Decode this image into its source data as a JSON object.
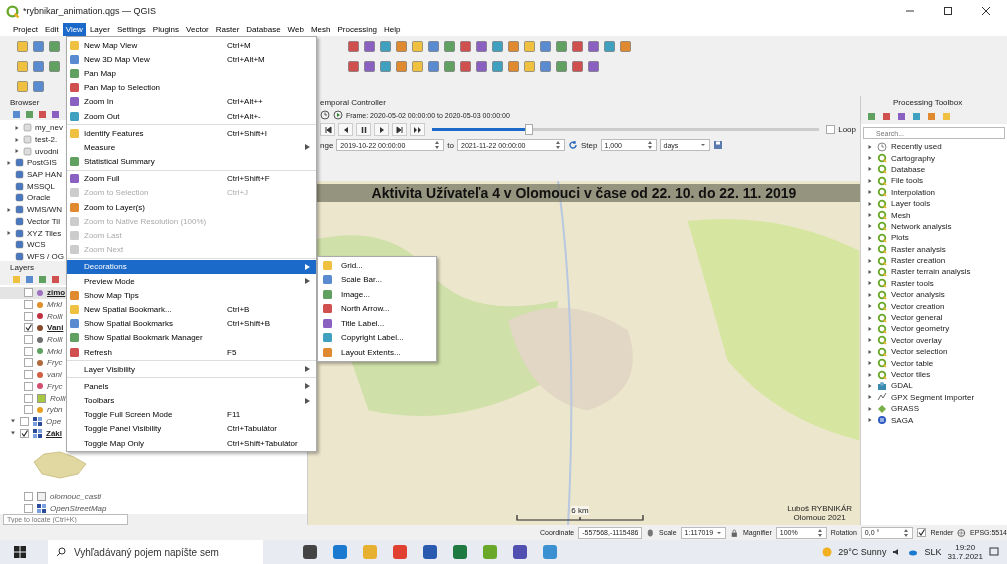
{
  "window": {
    "title": "*rybnikar_animation.qgs — QGIS"
  },
  "menubar": [
    {
      "label": "Project",
      "selected": false
    },
    {
      "label": "Edit",
      "selected": false
    },
    {
      "label": "View",
      "selected": true
    },
    {
      "label": "Layer",
      "selected": false
    },
    {
      "label": "Settings",
      "selected": false
    },
    {
      "label": "Plugins",
      "selected": false
    },
    {
      "label": "Vector",
      "selected": false
    },
    {
      "label": "Raster",
      "selected": false
    },
    {
      "label": "Database",
      "selected": false
    },
    {
      "label": "Web",
      "selected": false
    },
    {
      "label": "Mesh",
      "selected": false
    },
    {
      "label": "Processing",
      "selected": false
    },
    {
      "label": "Help",
      "selected": false
    }
  ],
  "browser": {
    "title": "Browser",
    "items": [
      {
        "label": "my_nev",
        "expandable": true,
        "indent": true
      },
      {
        "label": "test-2.",
        "expandable": true,
        "indent": true
      },
      {
        "label": "uvodni",
        "expandable": true,
        "indent": true
      },
      {
        "label": "PostGIS",
        "expandable": true,
        "indent": false
      },
      {
        "label": "SAP HAN",
        "expandable": false,
        "indent": false
      },
      {
        "label": "MSSQL",
        "expandable": false,
        "indent": false
      },
      {
        "label": "Oracle",
        "expandable": false,
        "indent": false
      },
      {
        "label": "WMS/WN",
        "expandable": true,
        "indent": false
      },
      {
        "label": "Vector Til",
        "expandable": false,
        "indent": false
      },
      {
        "label": "XYZ Tiles",
        "expandable": true,
        "indent": false
      },
      {
        "label": "WCS",
        "expandable": false,
        "indent": false
      },
      {
        "label": "WFS / OG",
        "expandable": false,
        "indent": false
      }
    ]
  },
  "layers": {
    "title": "Layers",
    "items": [
      {
        "kind": "point",
        "label": "zimo",
        "checked": false,
        "selected": true,
        "color": "#a070c0"
      },
      {
        "kind": "point",
        "label": "Mrkl",
        "checked": false,
        "selected": false,
        "color": "#e0902a"
      },
      {
        "kind": "point",
        "label": "Rolli",
        "checked": false,
        "selected": false,
        "color": "#c03040"
      },
      {
        "kind": "point",
        "label": "Vani",
        "checked": true,
        "selected": false,
        "color": "#8a4a2a"
      },
      {
        "kind": "point",
        "label": "Rolli",
        "checked": false,
        "selected": false,
        "color": "#707070"
      },
      {
        "kind": "point",
        "label": "Mrkl",
        "checked": false,
        "selected": false,
        "color": "#60a060"
      },
      {
        "kind": "point",
        "label": "Fryc",
        "checked": false,
        "selected": false,
        "color": "#b06a40"
      },
      {
        "kind": "point",
        "label": "vani",
        "checked": false,
        "selected": false,
        "color": "#d06040"
      },
      {
        "kind": "point",
        "label": "Fryc",
        "checked": false,
        "selected": false,
        "color": "#d05070"
      },
      {
        "kind": "polygon",
        "label": "Rolli",
        "checked": false,
        "selected": false,
        "color": "#a8c840"
      },
      {
        "kind": "point",
        "label": "rybn",
        "checked": false,
        "selected": false,
        "color": "#e8a020"
      },
      {
        "kind": "group",
        "label": "Ope",
        "checked": false,
        "selected": false,
        "expanded": true
      },
      {
        "kind": "group",
        "label": "Zákl",
        "checked": true,
        "selected": false,
        "expanded": true
      },
      {
        "kind": "thumbnail",
        "color": "#e0d8a0"
      },
      {
        "kind": "polygon",
        "label": "olomouc_casti",
        "checked": false,
        "selected": false,
        "color": "#f0f0f0"
      },
      {
        "kind": "group",
        "label": "OpenStreetMap",
        "checked": false,
        "selected": false,
        "expanded": false
      }
    ],
    "locate": {
      "placeholder": "Type to locate (Ctrl+K)"
    }
  },
  "view_menu": [
    {
      "kind": "item",
      "label": "New Map View",
      "shortcut": "Ctrl+M",
      "disabled": false,
      "selected": false,
      "submenu": false,
      "icon": true
    },
    {
      "kind": "item",
      "label": "New 3D Map View",
      "shortcut": "Ctrl+Alt+M",
      "disabled": false,
      "selected": false,
      "submenu": false,
      "icon": true
    },
    {
      "kind": "item",
      "label": "Pan Map",
      "disabled": false,
      "selected": false,
      "submenu": false,
      "icon": true
    },
    {
      "kind": "item",
      "label": "Pan Map to Selection",
      "disabled": false,
      "selected": false,
      "submenu": false,
      "icon": true
    },
    {
      "kind": "item",
      "label": "Zoom In",
      "shortcut": "Ctrl+Alt++",
      "disabled": false,
      "selected": false,
      "submenu": false,
      "icon": true
    },
    {
      "kind": "item",
      "label": "Zoom Out",
      "shortcut": "Ctrl+Alt+-",
      "disabled": false,
      "selected": false,
      "submenu": false,
      "icon": true
    },
    {
      "kind": "separator"
    },
    {
      "kind": "item",
      "label": "Identify Features",
      "shortcut": "Ctrl+Shift+I",
      "disabled": false,
      "selected": false,
      "submenu": false,
      "icon": true
    },
    {
      "kind": "item",
      "label": "Measure",
      "disabled": false,
      "selected": false,
      "submenu": true,
      "icon": false
    },
    {
      "kind": "item",
      "label": "Statistical Summary",
      "disabled": false,
      "selected": false,
      "submenu": false,
      "icon": true
    },
    {
      "kind": "separator"
    },
    {
      "kind": "item",
      "label": "Zoom Full",
      "shortcut": "Ctrl+Shift+F",
      "disabled": false,
      "selected": false,
      "submenu": false,
      "icon": true
    },
    {
      "kind": "item",
      "label": "Zoom to Selection",
      "shortcut": "Ctrl+J",
      "disabled": true,
      "selected": false,
      "submenu": false,
      "icon": true
    },
    {
      "kind": "item",
      "label": "Zoom to Layer(s)",
      "disabled": false,
      "selected": false,
      "submenu": false,
      "icon": true
    },
    {
      "kind": "item",
      "label": "Zoom to Native Resolution (100%)",
      "disabled": true,
      "selected": false,
      "submenu": false,
      "icon": true
    },
    {
      "kind": "item",
      "label": "Zoom Last",
      "disabled": true,
      "selected": false,
      "submenu": false,
      "icon": true
    },
    {
      "kind": "item",
      "label": "Zoom Next",
      "disabled": true,
      "selected": false,
      "submenu": false,
      "icon": true
    },
    {
      "kind": "separator"
    },
    {
      "kind": "item",
      "label": "Decorations",
      "disabled": false,
      "selected": true,
      "submenu": true,
      "icon": false
    },
    {
      "kind": "item",
      "label": "Preview Mode",
      "disabled": false,
      "selected": false,
      "submenu": true,
      "icon": false
    },
    {
      "kind": "item",
      "label": "Show Map Tips",
      "disabled": false,
      "selected": false,
      "submenu": false,
      "icon": true
    },
    {
      "kind": "item",
      "label": "New Spatial Bookmark...",
      "shortcut": "Ctrl+B",
      "disabled": false,
      "selected": false,
      "submenu": false,
      "icon": true
    },
    {
      "kind": "item",
      "label": "Show Spatial Bookmarks",
      "shortcut": "Ctrl+Shift+B",
      "disabled": false,
      "selected": false,
      "submenu": false,
      "icon": true
    },
    {
      "kind": "item",
      "label": "Show Spatial Bookmark Manager",
      "disabled": false,
      "selected": false,
      "submenu": false,
      "icon": true
    },
    {
      "kind": "item",
      "label": "Refresh",
      "shortcut": "F5",
      "disabled": false,
      "selected": false,
      "submenu": false,
      "icon": true
    },
    {
      "kind": "separator"
    },
    {
      "kind": "item",
      "label": "Layer Visibility",
      "disabled": false,
      "selected": false,
      "submenu": true,
      "icon": false
    },
    {
      "kind": "separator"
    },
    {
      "kind": "item",
      "label": "Panels",
      "disabled": false,
      "selected": false,
      "submenu": true,
      "icon": false
    },
    {
      "kind": "item",
      "label": "Toolbars",
      "disabled": false,
      "selected": false,
      "submenu": true,
      "icon": false
    },
    {
      "kind": "item",
      "label": "Toggle Full Screen Mode",
      "shortcut": "F11",
      "disabled": false,
      "selected": false,
      "submenu": false,
      "icon": false
    },
    {
      "kind": "item",
      "label": "Toggle Panel Visibility",
      "shortcut": "Ctrl+Tabulátor",
      "disabled": false,
      "selected": false,
      "submenu": false,
      "icon": false
    },
    {
      "kind": "item",
      "label": "Toggle Map Only",
      "shortcut": "Ctrl+Shift+Tabulátor",
      "disabled": false,
      "selected": false,
      "submenu": false,
      "icon": false
    }
  ],
  "decorations_menu": [
    "Grid...",
    "Scale Bar...",
    "Image...",
    "North Arrow...",
    "Title Label...",
    "Copyright Label...",
    "Layout Extents..."
  ],
  "temporal": {
    "title": "emporal Controller",
    "frame": "Frame: 2020-05-02 00:00:00 to 2020-05-03 00:00:00",
    "level": 0.25,
    "loop_label": "Loop",
    "loop": false,
    "range_label": "nge",
    "range_from": "2019-10-22 00:00:00",
    "to_label": "to",
    "range_to": "2021-11-22 00:00:00",
    "step_label": "Step",
    "step": "1,000",
    "unit": "days"
  },
  "map": {
    "title": "Aktivita Užívateľa 4 v Olomouci v čase od 22. 10. do 22. 11. 2019",
    "scale": "6 km",
    "author": "Luboš RYBNIKÁR",
    "place": "Olomouc 2021"
  },
  "toolbox": {
    "title": "Processing Toolbox",
    "placeholder": "Search...",
    "items": [
      {
        "kind": "recent",
        "label": "Recently used"
      },
      {
        "kind": "qgis",
        "label": "Cartography"
      },
      {
        "kind": "qgis",
        "label": "Database"
      },
      {
        "kind": "qgis",
        "label": "File tools"
      },
      {
        "kind": "qgis",
        "label": "Interpolation"
      },
      {
        "kind": "qgis",
        "label": "Layer tools"
      },
      {
        "kind": "qgis",
        "label": "Mesh"
      },
      {
        "kind": "qgis",
        "label": "Network analysis"
      },
      {
        "kind": "qgis",
        "label": "Plots"
      },
      {
        "kind": "qgis",
        "label": "Raster analysis"
      },
      {
        "kind": "qgis",
        "label": "Raster creation"
      },
      {
        "kind": "qgis",
        "label": "Raster terrain analysis"
      },
      {
        "kind": "qgis",
        "label": "Raster tools"
      },
      {
        "kind": "qgis",
        "label": "Vector analysis"
      },
      {
        "kind": "qgis",
        "label": "Vector creation"
      },
      {
        "kind": "qgis",
        "label": "Vector general"
      },
      {
        "kind": "qgis",
        "label": "Vector geometry"
      },
      {
        "kind": "qgis",
        "label": "Vector overlay"
      },
      {
        "kind": "qgis",
        "label": "Vector selection"
      },
      {
        "kind": "qgis",
        "label": "Vector table"
      },
      {
        "kind": "qgis",
        "label": "Vector tiles"
      },
      {
        "kind": "gdal",
        "label": "GDAL"
      },
      {
        "kind": "gpx",
        "label": "GPX Segment Importer"
      },
      {
        "kind": "grass",
        "label": "GRASS"
      },
      {
        "kind": "saga",
        "label": "SAGA"
      }
    ]
  },
  "status_bar": {
    "coordinate_label": "Coordinate",
    "coordinate": "-557568,-1115486",
    "scale_label": "Scale",
    "scale": "1:117019",
    "magnifier_label": "Magnifier",
    "magnifier": "100%",
    "rotation_label": "Rotation",
    "rotation": "0,0 °",
    "render_label": "Render",
    "render": true,
    "crs": "EPSG:5514"
  },
  "taskbar": {
    "search_placeholder": "Vyhľadávaný pojem napíšte sem",
    "weather": "29°C Sunny",
    "language": "SLK",
    "time": "19:20",
    "date": "31.7.2021"
  }
}
